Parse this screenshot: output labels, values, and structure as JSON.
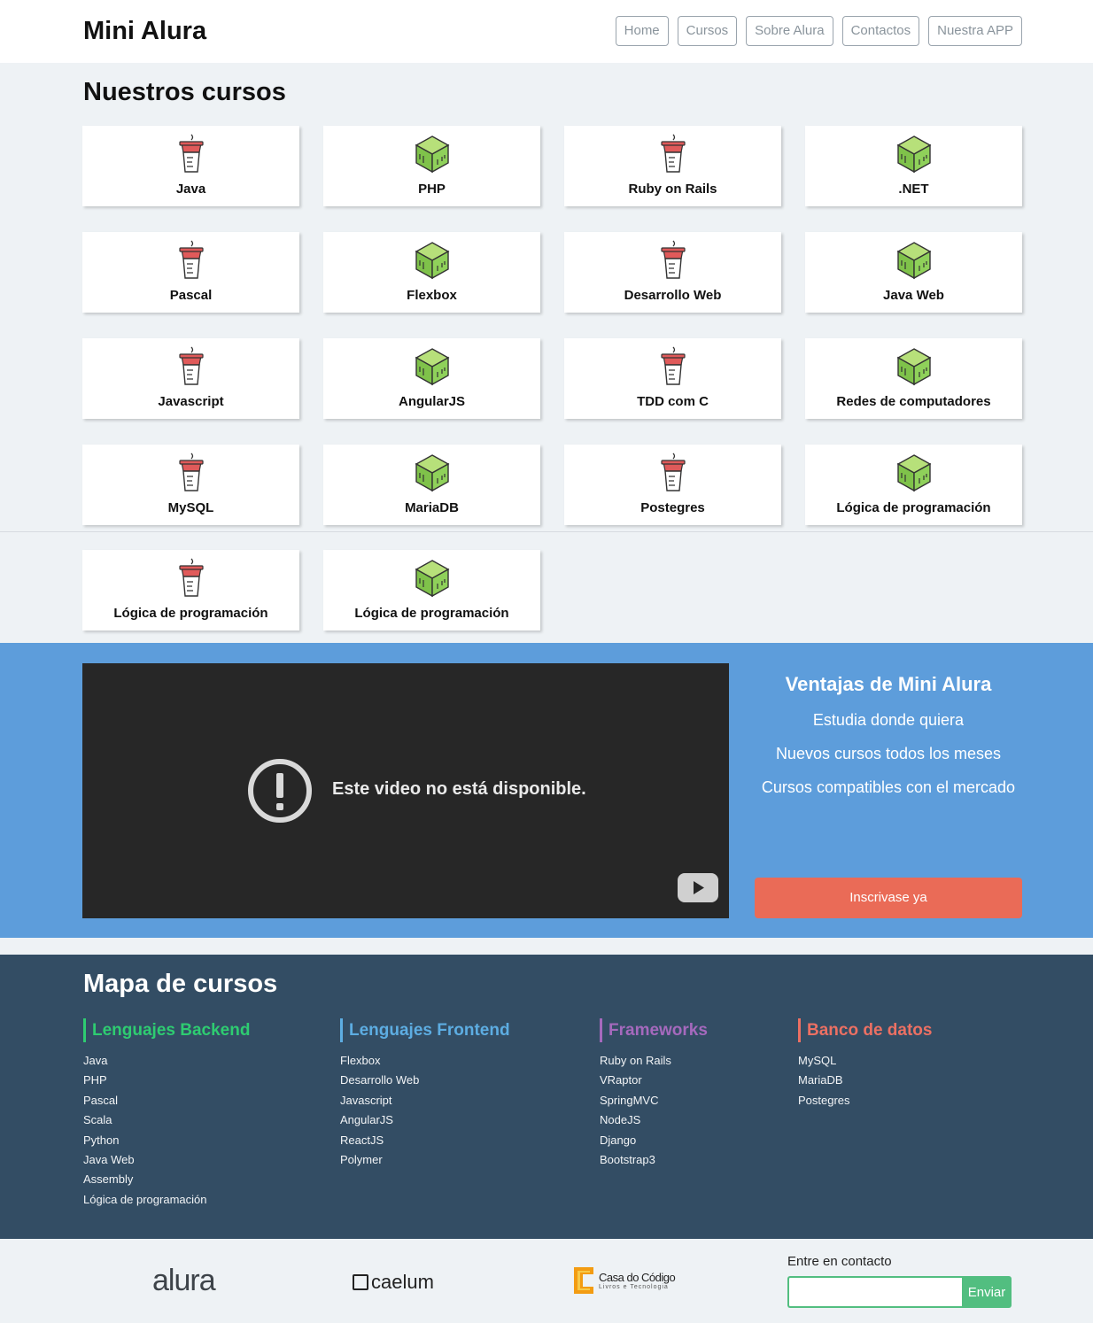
{
  "header": {
    "logo": "Mini Alura",
    "nav": [
      "Home",
      "Cursos",
      "Sobre Alura",
      "Contactos",
      "Nuestra APP"
    ]
  },
  "courses": {
    "title": "Nuestros cursos",
    "items": [
      {
        "label": "Java",
        "icon": "cup-icon"
      },
      {
        "label": "PHP",
        "icon": "cube-icon"
      },
      {
        "label": "Ruby on Rails",
        "icon": "cup-icon"
      },
      {
        "label": ".NET",
        "icon": "cube-icon"
      },
      {
        "label": "Pascal",
        "icon": "cup-icon"
      },
      {
        "label": "Flexbox",
        "icon": "cube-icon"
      },
      {
        "label": "Desarrollo Web",
        "icon": "cup-icon"
      },
      {
        "label": "Java Web",
        "icon": "cube-icon"
      },
      {
        "label": "Javascript",
        "icon": "cup-icon"
      },
      {
        "label": "AngularJS",
        "icon": "cube-icon"
      },
      {
        "label": "TDD com C",
        "icon": "cup-icon"
      },
      {
        "label": "Redes de computadores",
        "icon": "cube-icon"
      },
      {
        "label": "MySQL",
        "icon": "cup-icon"
      },
      {
        "label": "MariaDB",
        "icon": "cube-icon"
      },
      {
        "label": "Postegres",
        "icon": "cup-icon"
      },
      {
        "label": "Lógica de programación",
        "icon": "cube-icon"
      },
      {
        "label": "Lógica de programación",
        "icon": "cup-icon"
      },
      {
        "label": "Lógica de programación",
        "icon": "cube-icon"
      }
    ]
  },
  "video": {
    "message": "Este video no está disponible."
  },
  "advantages": {
    "title": "Ventajas de Mini Alura",
    "items": [
      "Estudia donde quiera",
      "Nuevos cursos todos los meses",
      "Cursos compatibles con el mercado"
    ],
    "cta": "Inscrivase ya"
  },
  "map": {
    "title": "Mapa de cursos",
    "columns": [
      {
        "title": "Lenguajes Backend",
        "color": "#2ecc71",
        "items": [
          "Java",
          "PHP",
          "Pascal",
          "Scala",
          "Python",
          "Java Web",
          "Assembly",
          "Lógica de programación"
        ]
      },
      {
        "title": "Lenguajes Frontend",
        "color": "#5dade2",
        "items": [
          "Flexbox",
          "Desarrollo Web",
          "Javascript",
          "AngularJS",
          "ReactJS",
          "Polymer"
        ]
      },
      {
        "title": "Frameworks",
        "color": "#a569bd",
        "items": [
          "Ruby on Rails",
          "VRaptor",
          "SpringMVC",
          "NodeJS",
          "Django",
          "Bootstrap3"
        ]
      },
      {
        "title": "Banco de datos",
        "color": "#ec7063",
        "items": [
          "MySQL",
          "MariaDB",
          "Postegres"
        ]
      }
    ]
  },
  "footer": {
    "brands": {
      "alura": "alura",
      "caelum": "caelum",
      "casa": "Casa do Código",
      "casa_sub": "Livros e Tecnologia"
    },
    "contact_label": "Entre en contacto",
    "contact_placeholder": "",
    "send": "Enviar"
  }
}
